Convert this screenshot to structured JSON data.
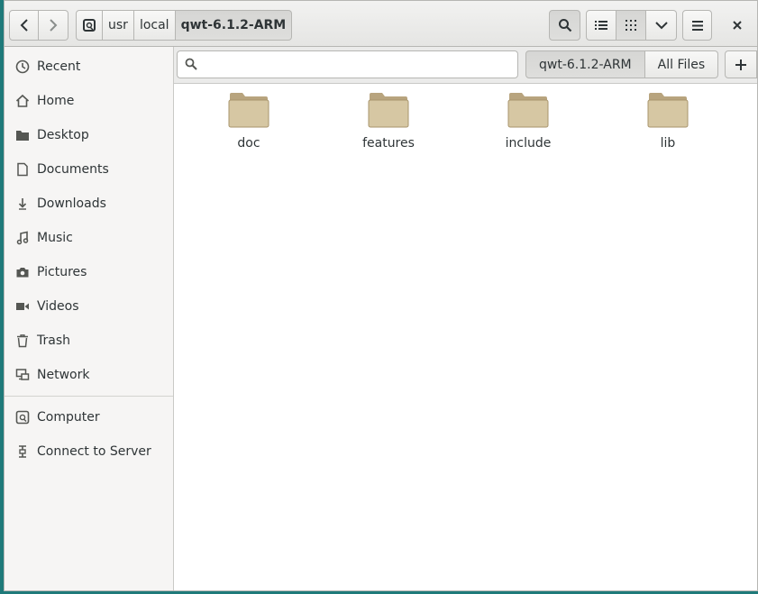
{
  "breadcrumbs": [
    "usr",
    "local",
    "qwt-6.1.2-ARM"
  ],
  "sidebar": {
    "places": [
      {
        "label": "Recent",
        "icon": "clock-icon"
      },
      {
        "label": "Home",
        "icon": "home-icon"
      },
      {
        "label": "Desktop",
        "icon": "folder-icon"
      },
      {
        "label": "Documents",
        "icon": "document-icon"
      },
      {
        "label": "Downloads",
        "icon": "download-icon"
      },
      {
        "label": "Music",
        "icon": "music-icon"
      },
      {
        "label": "Pictures",
        "icon": "camera-icon"
      },
      {
        "label": "Videos",
        "icon": "video-icon"
      },
      {
        "label": "Trash",
        "icon": "trash-icon"
      },
      {
        "label": "Network",
        "icon": "network-icon"
      }
    ],
    "devices": [
      {
        "label": "Computer",
        "icon": "drive-icon"
      },
      {
        "label": "Connect to Server",
        "icon": "server-connect-icon"
      }
    ]
  },
  "search": {
    "value": "",
    "placeholder": "",
    "scope_current": "qwt-6.1.2-ARM",
    "scope_all": "All Files"
  },
  "files": [
    {
      "name": "doc"
    },
    {
      "name": "features"
    },
    {
      "name": "include"
    },
    {
      "name": "lib"
    }
  ],
  "colors": {
    "folder": "#d6c7a3",
    "folder_tab": "#b8a47e",
    "sidebar_bg": "#f6f5f4",
    "desktop_bg": "#1f7a7a"
  }
}
